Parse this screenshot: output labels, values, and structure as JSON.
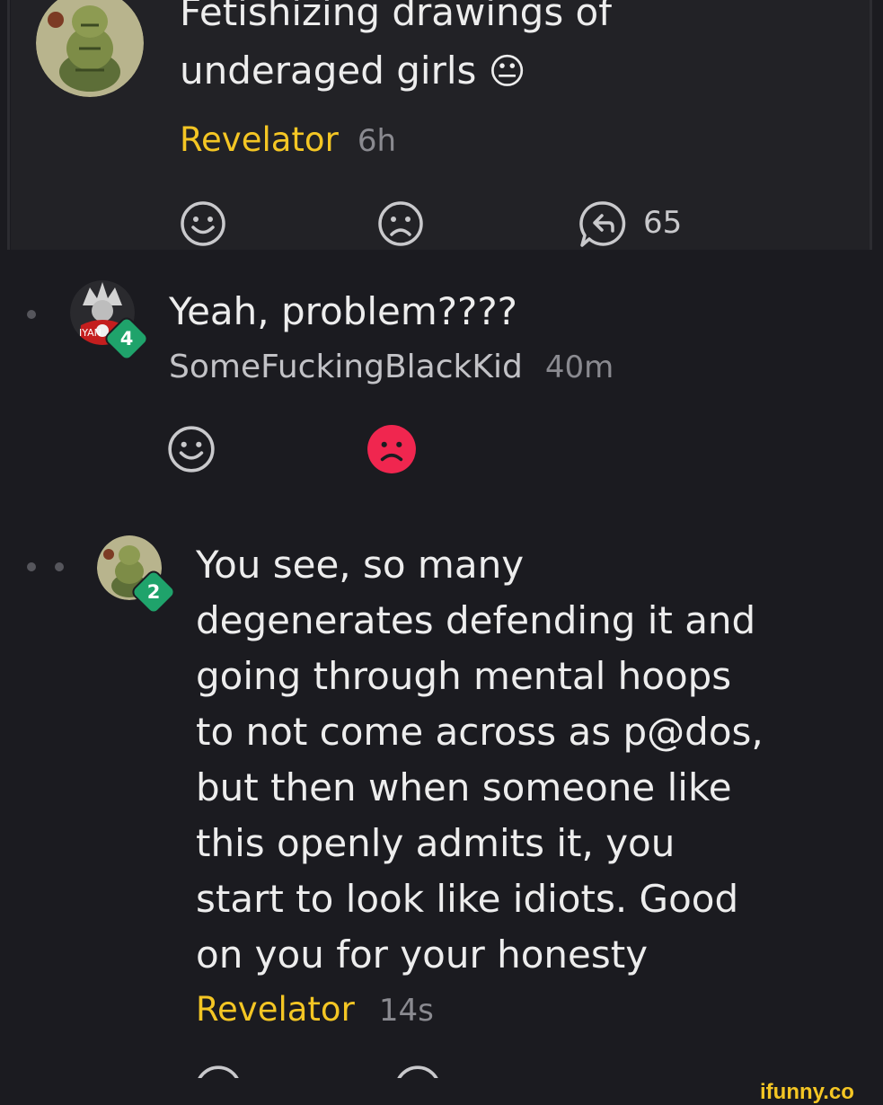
{
  "post": {
    "text_line1": "Fetishizing drawings of",
    "text_line2": "underaged girls",
    "emoji": "😐",
    "username": "Revelator",
    "time": "6h",
    "reply_count": "65"
  },
  "comments": [
    {
      "text": "Yeah, problem????",
      "username": "SomeFuckingBlackKid",
      "time": "40m",
      "level": "4",
      "avatar_label": "IYAN"
    },
    {
      "lines": [
        "You see, so many",
        "degenerates defending it and",
        "going through mental hoops",
        "to not come across as p@dos,",
        "but then when someone like",
        "this openly admits it, you",
        "start to look like idiots. Good",
        "on you for your honesty"
      ],
      "username": "Revelator",
      "time": "14s",
      "level": "2"
    }
  ],
  "watermark": "ifunny.co",
  "colors": {
    "background": "#1b1b20",
    "username": "#f4c624",
    "dislike_active": "#f0264f",
    "level_badge": "#1fa36b",
    "watermark": "#f4c624"
  },
  "icons": [
    "smile-icon",
    "frown-icon",
    "reply-icon",
    "frown-icon-active"
  ]
}
